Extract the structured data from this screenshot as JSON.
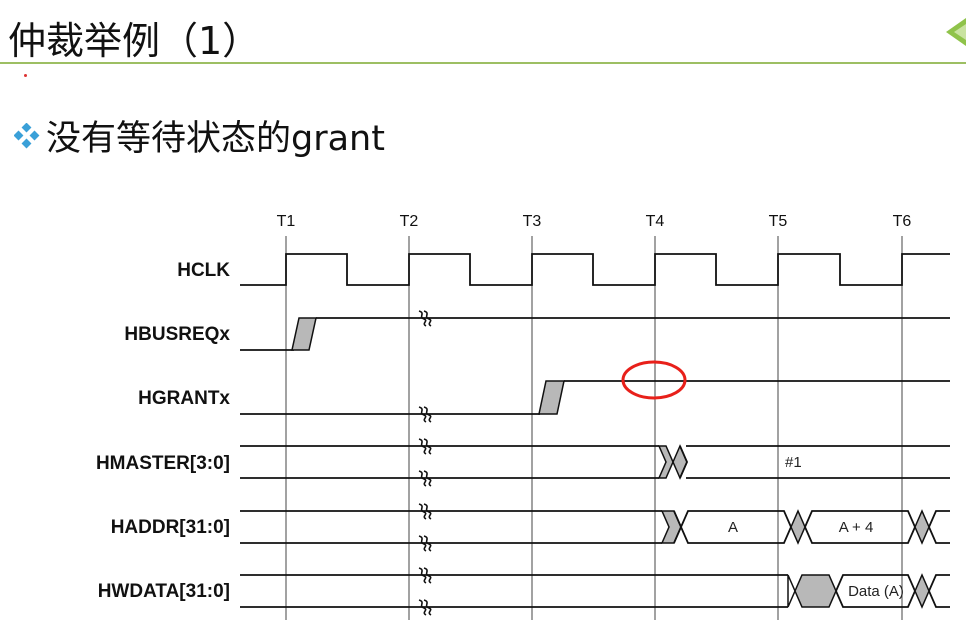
{
  "slide": {
    "title": "仲裁举例（1）",
    "bullet": "没有等待状态的grant"
  },
  "timing": {
    "clock_labels": [
      "T1",
      "T2",
      "T3",
      "T4",
      "T5",
      "T6"
    ],
    "signals": {
      "hclk": "HCLK",
      "hbusreq": "HBUSREQx",
      "hgrant": "HGRANTx",
      "hmaster": "HMASTER[3:0]",
      "haddr": "HADDR[31:0]",
      "hwdata": "HWDATA[31:0]"
    },
    "values": {
      "hmaster_value": "#1",
      "haddr_a": "A",
      "haddr_a4": "A + 4",
      "hwdata_a": "Data (A)"
    },
    "colors": {
      "highlight_circle": "#e8201a",
      "transition_fill": "#b8b8b8",
      "title_rule": "#9dbf63",
      "bullet": "#3aa0d8"
    }
  }
}
